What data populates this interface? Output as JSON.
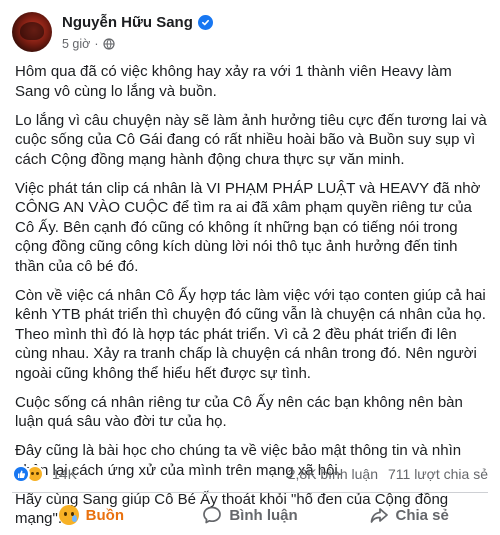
{
  "post": {
    "author": "Nguyễn Hữu Sang",
    "time": "5 giờ",
    "dot": "·",
    "paragraphs": [
      "Hôm qua đã có việc không hay xảy ra với 1 thành viên Heavy làm Sang vô cùng lo lắng và buồn.",
      "Lo lắng vì câu chuyện này sẽ làm ảnh hưởng tiêu cực đến tương lai và cuộc sống của Cô Gái đang có rất nhiều hoài bão và Buồn suy sụp vì cách Cộng đồng mạng hành động chưa thực sự văn minh.",
      "Việc phát tán clip cá nhân là VI PHẠM PHÁP LUẬT và HEAVY đã nhờ CÔNG AN VÀO CUỘC để tìm ra ai đã xâm phạm quyền riêng tư của Cô Ấy. Bên cạnh đó cũng có không ít những bạn có tiếng nói trong cộng đồng cũng công kích dùng lời nói thô tục ảnh hưởng đến tinh thần của cô bé đó.",
      "Còn về việc cá nhân Cô Ấy hợp tác làm việc với tạo conten giúp cả hai kênh YTB phát triển thì chuyện đó cũng vẫn là chuyện cá nhân của họ. Theo mình thì đó là hợp tác phát triển. Vì cả 2 đều phát triển đi lên cùng nhau. Xảy ra tranh chấp là chuyện cá nhân trong đó. Nên người ngoài cũng không thể hiểu hết được sự tình.",
      "Cuộc sống cá nhân riêng tư của Cô Ấy nên các bạn không nên bàn luận quá sâu vào đời tư của họ.",
      "Đây cũng là bài học cho chúng ta về việc bảo mật thông tin và nhìn nhận lại cách ứng xử của mình trên mạng xã hội.",
      "Hãy cùng Sang giúp Cô Bé Ấy thoát khỏi \"hố đen của Cộng đồng mạng\"."
    ]
  },
  "reactions": {
    "icons": [
      "like-icon",
      "sad-icon"
    ],
    "count": "14K",
    "comments": "2,8K bình luận",
    "shares": "711 lượt chia sẻ"
  },
  "actions": {
    "react_label": "Buồn",
    "comment_label": "Bình luận",
    "share_label": "Chia sẻ"
  },
  "colors": {
    "verified": "#1877f2",
    "sad_active": "#e9710f",
    "text_secondary": "#65676b"
  }
}
